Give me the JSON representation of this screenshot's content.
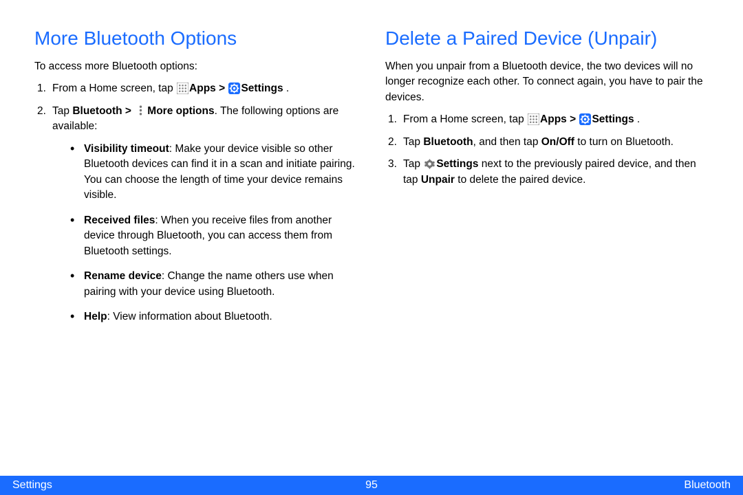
{
  "left": {
    "heading": "More Bluetooth Options",
    "intro": "To access more Bluetooth options:",
    "step1_a": "From a Home screen, tap ",
    "step1_apps": "Apps > ",
    "step1_settings": "Settings",
    "step1_end": " .",
    "step2_a": "Tap ",
    "step2_bt": "Bluetooth > ",
    "step2_more": "More options",
    "step2_end": ". The following options are available:",
    "bul1_t": "Visibility timeout",
    "bul1_b": ": Make your device visible so other Bluetooth devices can find it in a scan and initiate pairing. You can choose the length of time your device remains visible.",
    "bul2_t": "Received files",
    "bul2_b": ": When you receive files from another device through Bluetooth, you can access them from Bluetooth settings.",
    "bul3_t": "Rename device",
    "bul3_b": ": Change the name others use when pairing with your device using Bluetooth.",
    "bul4_t": "Help",
    "bul4_b": ": View information about Bluetooth."
  },
  "right": {
    "heading": "Delete a Paired Device (Unpair)",
    "intro": "When you unpair from a Bluetooth device, the two devices will no longer recognize each other. To connect again, you have to pair the devices.",
    "step1_a": "From a Home screen, tap ",
    "step1_apps": "Apps >  ",
    "step1_settings": "Settings",
    "step1_end": " .",
    "step2_a": "Tap ",
    "step2_bt": "Bluetooth",
    "step2_mid": ", and then tap ",
    "step2_onoff": "On/Off",
    "step2_end": " to turn on Bluetooth.",
    "step3_a": "Tap ",
    "step3_settings": "Settings",
    "step3_mid": "  next to the previously paired device, and then tap ",
    "step3_unpair": "Unpair",
    "step3_end": " to delete the paired device."
  },
  "footer": {
    "left": "Settings",
    "page": "95",
    "right": "Bluetooth"
  }
}
